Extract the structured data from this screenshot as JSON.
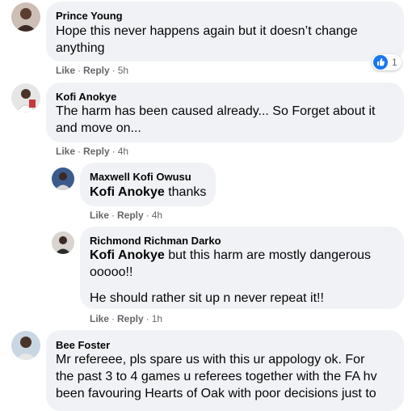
{
  "comments": [
    {
      "author": "Prince Young",
      "lines": [
        "Hope this never happens again but it doesn’t change",
        "anything"
      ],
      "actions": {
        "like": "Like",
        "reply": "Reply",
        "time": "5h"
      },
      "reaction": {
        "icon": "like-reaction-icon",
        "count": "1",
        "color": "#1877f2"
      }
    },
    {
      "author": "Kofi Anokye",
      "lines": [
        "The harm has been caused already... So Forget about it",
        "and move on..."
      ],
      "actions": {
        "like": "Like",
        "reply": "Reply",
        "time": "4h"
      }
    },
    {
      "author": "Maxwell Kofi Owusu",
      "mention": "Kofi Anokye",
      "text": " thanks",
      "actions": {
        "like": "Like",
        "reply": "Reply",
        "time": "4h"
      }
    },
    {
      "author": "Richmond Richman Darko",
      "mention": "Kofi Anokye",
      "text": " but this harm are mostly dangerous",
      "line2": "ooooo!!",
      "line3": "He should rather sit up n never repeat it!!",
      "actions": {
        "like": "Like",
        "reply": "Reply",
        "time": "1h"
      }
    },
    {
      "author": "Bee Foster",
      "lines": [
        "Mr refereee, pls spare us with this ur appology ok. For",
        "the past 3 to 4 games u referees together with the FA hv",
        "been favouring Hearts of Oak with poor decisions just to"
      ]
    }
  ],
  "separator": "·",
  "colors": {
    "bubble": "#f0f2f5",
    "secondary_text": "#65676b",
    "like_blue": "#1877f2"
  }
}
